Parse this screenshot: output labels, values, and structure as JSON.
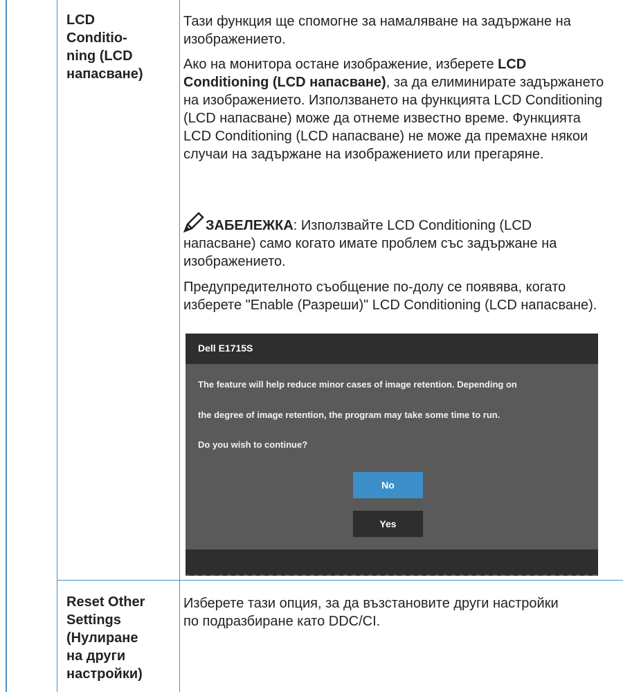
{
  "rows": [
    {
      "label": "LCD Conditio-ning (LCD напасване)",
      "label_lines": [
        "LCD",
        "Conditio-",
        "ning (LCD",
        "напасване)"
      ],
      "para1": "Тази функция ще спомогне за намаляване на задържане на изображението.",
      "para2_a": "Ако на монитора остане изображение, изберете ",
      "para2_bold": "LCD Conditioning (LCD напасване)",
      "para2_b": ", за да елиминирате задържането на изображението. Използването на функцията LCD Conditioning (LCD напасване) може да отнеме известно време. Функцията LCD Conditioning (LCD напасване) не може да премахне някои случаи на задържане на изображението или прегаряне.",
      "note_label": "ЗАБЕЛЕЖКА",
      "note_text": ": Използвайте LCD Conditioning (LCD напасване) само когато имате проблем със задържане на изображението.",
      "para3": "Предупредителното съобщение по-долу се появява, когато изберете \"Enable (Разреши)\" LCD Conditioning (LCD напасване)."
    },
    {
      "label_lines": [
        "Reset Other",
        "Settings",
        "(Нулиране",
        "на други",
        "настройки)"
      ],
      "description": "Изберете тази опция, за да възстановите други настройки по подразбиране като DDC/CI."
    }
  ],
  "osd": {
    "title": "Dell E1715S",
    "message_line1": "The feature will help reduce minor cases of image retention. Depending on",
    "message_line2": "the degree of image retention, the program may take some time to run.",
    "message_line3": "Do you wish to continue?",
    "no_label": "No",
    "yes_label": "Yes"
  },
  "colors": {
    "border": "#4a90c9",
    "osd_bg": "#5a5a5a",
    "osd_bar": "#2e2e2e",
    "no_button": "#3d8fc9"
  }
}
